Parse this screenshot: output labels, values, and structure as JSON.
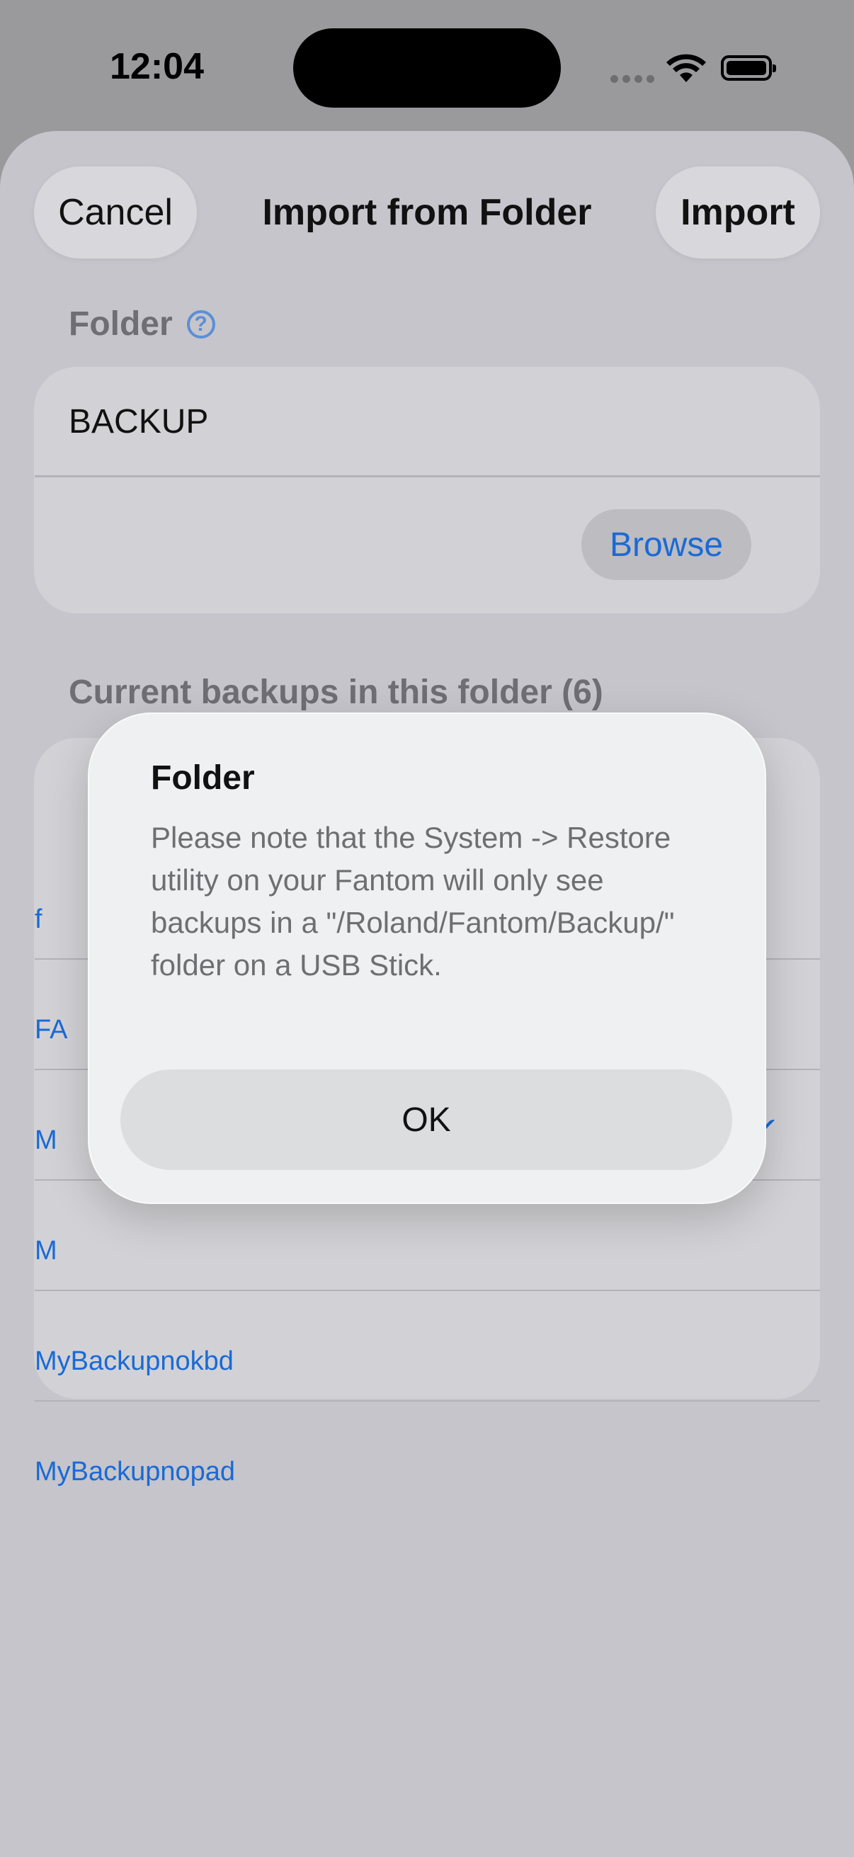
{
  "status_bar": {
    "time": "12:04"
  },
  "header": {
    "cancel_label": "Cancel",
    "title": "Import from Folder",
    "import_label": "Import"
  },
  "folder_section": {
    "label": "Folder",
    "help_icon": "?",
    "value": "BACKUP",
    "browse_label": "Browse"
  },
  "backups_section": {
    "label": "Current backups in this folder (6)",
    "items": [
      {
        "label": "f"
      },
      {
        "label": "FA"
      },
      {
        "label": "M"
      },
      {
        "label": "M"
      },
      {
        "label": "MyBackupnokbd"
      },
      {
        "label": "MyBackupnopad"
      }
    ],
    "checkmark": "✓"
  },
  "alert": {
    "title": "Folder",
    "message": "Please note that the System -> Restore utility on your Fantom will only see backups in a \"/Roland/Fantom/Backup/\" folder on a USB Stick.",
    "ok_label": "OK"
  },
  "colors": {
    "accent": "#1a6ad6",
    "sheet_bg": "#c5c5cb",
    "alert_bg": "#eff0f1"
  }
}
